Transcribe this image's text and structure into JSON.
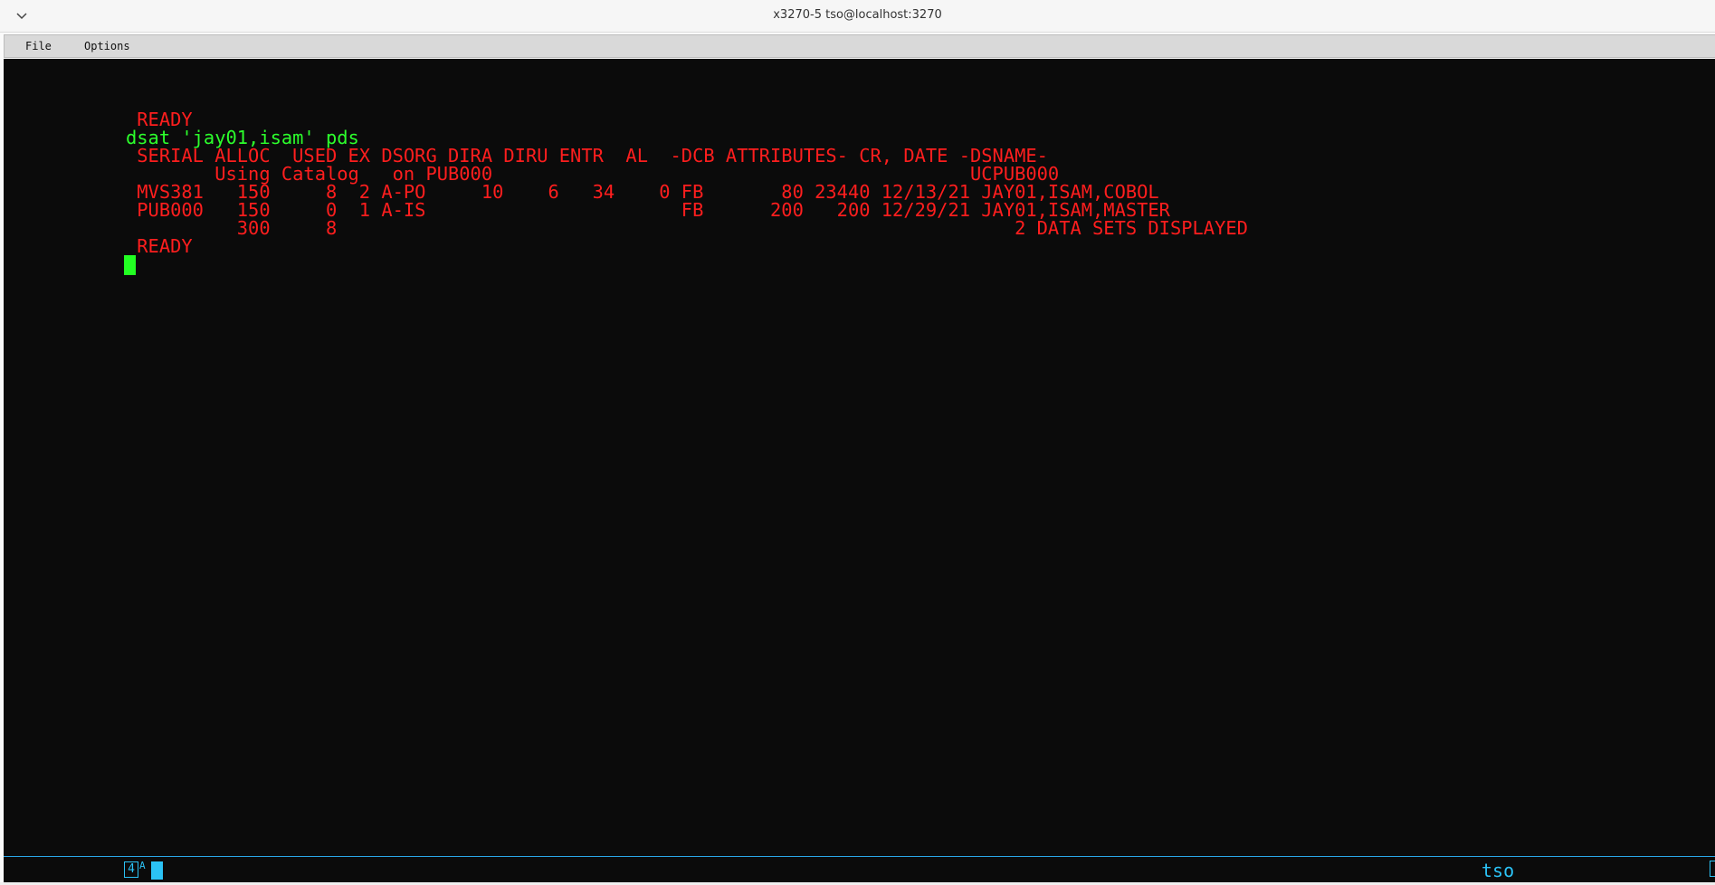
{
  "window": {
    "title": "x3270-5 tso@localhost:3270",
    "chevron_icon": "chevron-down-icon"
  },
  "menu": {
    "file": "File",
    "options": "Options"
  },
  "terminal": {
    "lines": [
      " READY",
      "dsat 'jay01,isam' pds",
      " SERIAL ALLOC  USED EX DSORG DIRA DIRU ENTR  AL  -DCB ATTRIBUTES- CR, DATE -DSNAME-",
      "        Using Catalog   on PUB000                                           UCPUB000",
      " MVS381   150     8  2 A-PO     10    6   34    0 FB       80 23440 12/13/21 JAY01,ISAM,COBOL",
      " PUB000   150     0  1 A-IS                       FB      200   200 12/29/21 JAY01,ISAM,MASTER",
      "          300     8                                                             2 DATA SETS DISPLAYED",
      " READY"
    ],
    "colors": {
      "output": "#ff1e1e",
      "input": "#2cff2c",
      "background": "#0b0b0b"
    }
  },
  "status": {
    "indicator": "4",
    "mode": "A",
    "lu_name": "tso",
    "accent": "#2bc2f5"
  }
}
